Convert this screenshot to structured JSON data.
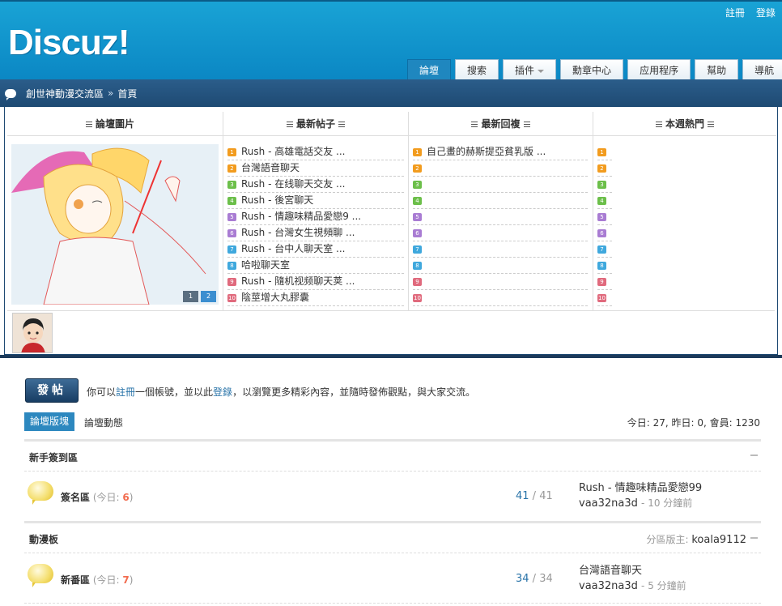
{
  "header": {
    "logo": "Discuz!",
    "top_links": [
      "註冊",
      "登錄"
    ],
    "nav": [
      {
        "label": "論壇",
        "active": true
      },
      {
        "label": "搜索"
      },
      {
        "label": "插件",
        "dropdown": true
      },
      {
        "label": "勳章中心"
      },
      {
        "label": "应用程序"
      },
      {
        "label": "幫助"
      },
      {
        "label": "導航"
      }
    ]
  },
  "breadcrumb": {
    "site": "創世神動漫交流區",
    "separator": "»",
    "current": "首頁"
  },
  "portal": {
    "columns": [
      "論壇圖片",
      "最新帖子",
      "最新回複",
      "本週熱門"
    ],
    "slider_buttons": [
      "1",
      "2"
    ],
    "latest_posts": [
      "Rush - 高雄電話交友 ...",
      "台灣語音聊天",
      "Rush - 在线聊天交友 ...",
      "Rush - 後宮聊天",
      "Rush - 情趣味精品愛戀9 ...",
      "Rush - 台灣女生視頻聊 ...",
      "Rush - 台中人聊天室 ...",
      "哈啦聊天室",
      "Rush - 隨机视频聊天荚 ...",
      "陰莖增大丸膠囊"
    ],
    "latest_replies": [
      "自己畫的赫斯提亞貧乳版 ...",
      "",
      "",
      "",
      "",
      "",
      "",
      "",
      "",
      ""
    ],
    "weekly_hot": [
      "",
      "",
      "",
      "",
      "",
      "",
      "",
      "",
      "",
      ""
    ],
    "rank_colors": [
      "#f29c1f",
      "#f29c1f",
      "#6cbf4a",
      "#6cbf4a",
      "#a97cd3",
      "#a97cd3",
      "#3fa8dd",
      "#3fa8dd",
      "#e06a7d",
      "#e06a7d"
    ]
  },
  "main": {
    "post_button": "發帖",
    "invite": {
      "pre": "你可以",
      "register": "註冊",
      "mid": "一個帳號，並以此",
      "login": "登錄",
      "post": "，以瀏覽更多精彩內容，並隨時發佈觀點，與大家交流。"
    },
    "tabs": [
      "論壇版塊",
      "論壇動態"
    ],
    "stats": "今日: 27, 昨日: 0, 會員: 1230",
    "groups": [
      {
        "title": "新手簽到區",
        "moderator_label": "",
        "moderator": "",
        "forum": {
          "name": "簽名區",
          "today_label": "(今日: ",
          "today_count": "6",
          "today_close": ")",
          "threads": "41",
          "posts": "41",
          "last_title": "Rush - 情趣味精品愛戀99",
          "last_user": "vaa32na3d",
          "last_time": "- 10 分鐘前"
        }
      },
      {
        "title": "動漫板",
        "moderator_label": "分區版主:",
        "moderator": "koala9112",
        "forum": {
          "name": "新番區",
          "today_label": "(今日: ",
          "today_count": "7",
          "today_close": ")",
          "threads": "34",
          "posts": "34",
          "last_title": "台灣語音聊天",
          "last_user": "vaa32na3d",
          "last_time": "- 5 分鐘前"
        }
      }
    ]
  }
}
